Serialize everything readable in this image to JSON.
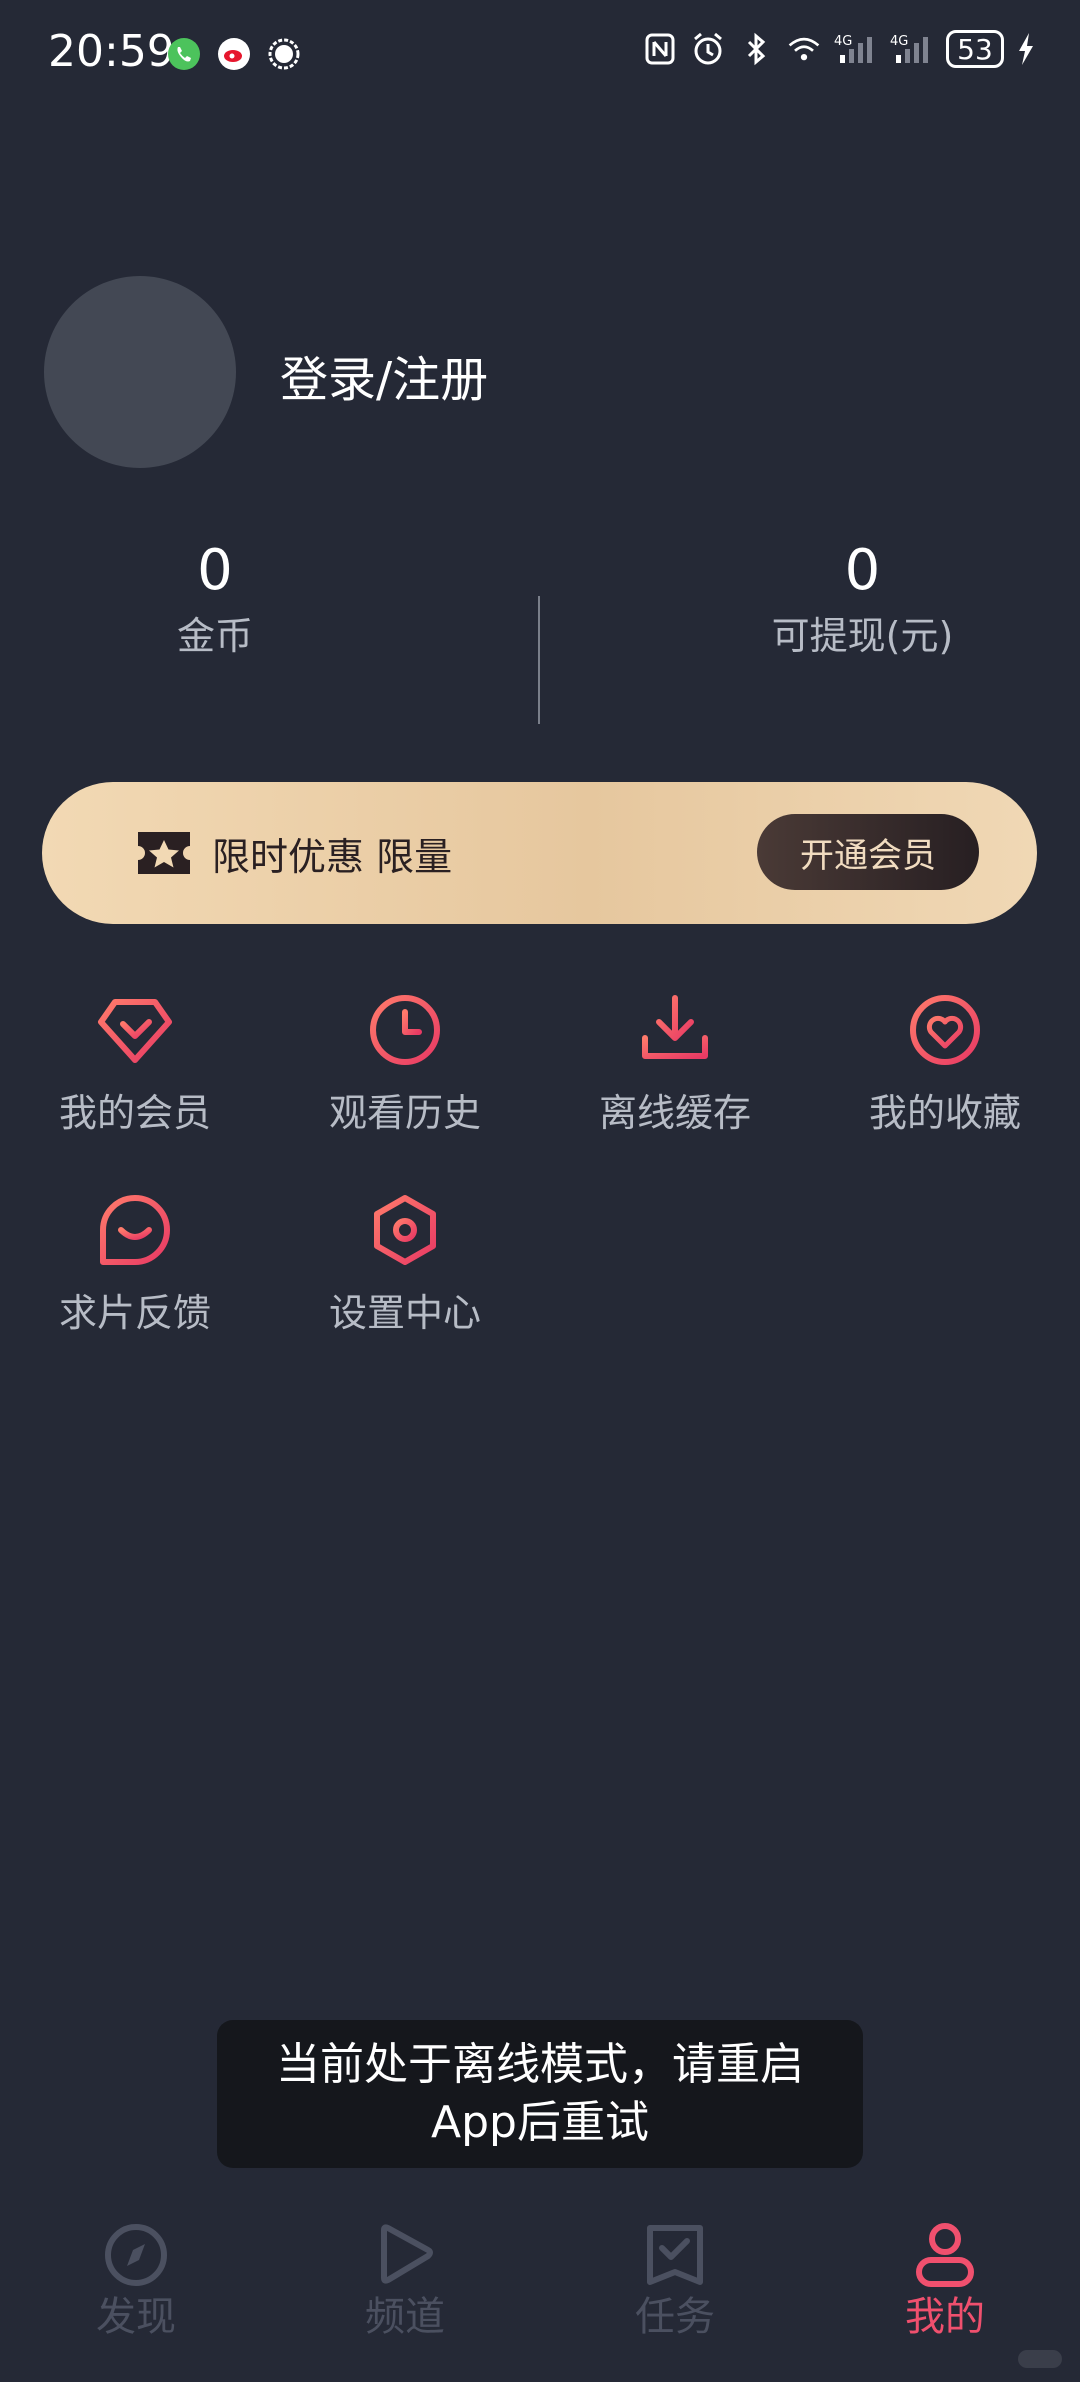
{
  "status_bar": {
    "time": "20:59",
    "battery": "53"
  },
  "profile": {
    "login_text": "登录/注册"
  },
  "stats": {
    "coins": {
      "value": "0",
      "label": "金币"
    },
    "withdrawable": {
      "value": "0",
      "label": "可提现(元)"
    }
  },
  "vip_banner": {
    "text": "限时优惠 限量",
    "button": "开通会员"
  },
  "menu": [
    {
      "label": "我的会员",
      "icon": "diamond-icon"
    },
    {
      "label": "观看历史",
      "icon": "clock-icon"
    },
    {
      "label": "离线缓存",
      "icon": "download-icon"
    },
    {
      "label": "我的收藏",
      "icon": "heart-icon"
    },
    {
      "label": "求片反馈",
      "icon": "feedback-icon"
    },
    {
      "label": "设置中心",
      "icon": "settings-icon"
    }
  ],
  "toast": {
    "message": "当前处于离线模式，请重启App后重试"
  },
  "bottom_nav": [
    {
      "label": "发现",
      "icon": "compass-icon",
      "active": false
    },
    {
      "label": "频道",
      "icon": "play-icon",
      "active": false
    },
    {
      "label": "任务",
      "icon": "task-icon",
      "active": false
    },
    {
      "label": "我的",
      "icon": "user-icon",
      "active": true
    }
  ],
  "colors": {
    "background": "#252936",
    "accent": "#f0506e",
    "banner_gold": "#e6c79e"
  }
}
